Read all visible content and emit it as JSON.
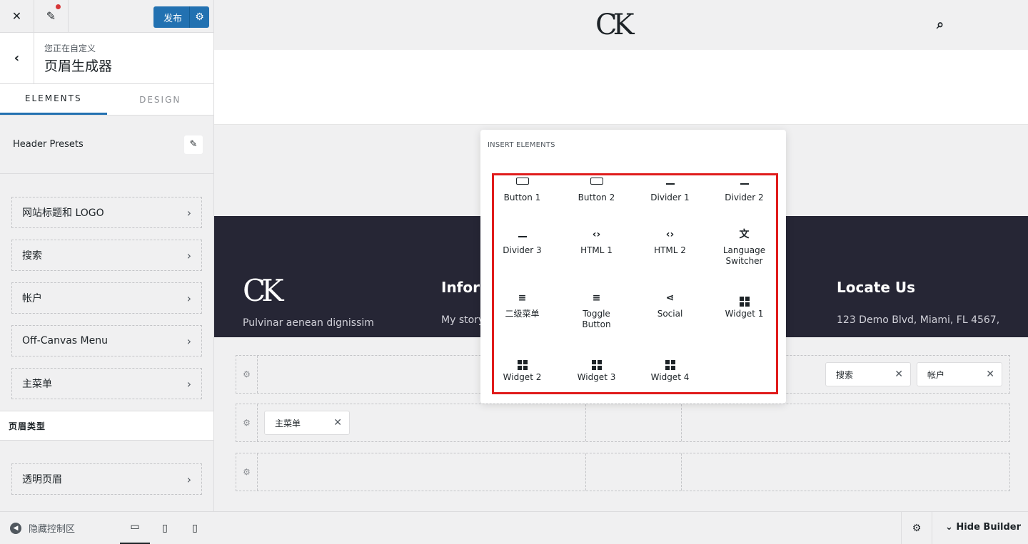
{
  "sidebar": {
    "publish_label": "发布",
    "crumb_sub": "您正在自定义",
    "crumb_title": "页眉生成器",
    "tabs": [
      "ELEMENTS",
      "DESIGN"
    ],
    "presets_label": "Header Presets",
    "items": [
      "网站标题和 LOGO",
      "搜索",
      "帐户",
      "Off-Canvas Menu",
      "主菜单"
    ],
    "section_title": "页眉类型",
    "transparent_item": "透明页眉",
    "hide_controls": "隐藏控制区"
  },
  "preview": {
    "logo": "CK",
    "footer_logo": "CK",
    "footer_text": "Pulvinar aenean dignissim",
    "info_heading": "Infor",
    "story_text": "My story",
    "locate_heading": "Locate Us",
    "address": "123 Demo Blvd, Miami, FL 4567,"
  },
  "builder": {
    "chip_search": "搜索",
    "chip_account": "帐户",
    "chip_menu": "主菜单",
    "hide_builder": "Hide Builder"
  },
  "popup": {
    "title": "INSERT ELEMENTS",
    "elements": [
      {
        "label": "Button 1",
        "icon": "button-icon"
      },
      {
        "label": "Button 2",
        "icon": "button-icon"
      },
      {
        "label": "Divider 1",
        "icon": "divider-icon"
      },
      {
        "label": "Divider 2",
        "icon": "divider-icon"
      },
      {
        "label": "Divider 3",
        "icon": "divider-icon"
      },
      {
        "label": "HTML 1",
        "icon": "code-icon"
      },
      {
        "label": "HTML 2",
        "icon": "code-icon"
      },
      {
        "label": "Language Switcher",
        "icon": "translate-icon"
      },
      {
        "label": "二级菜单",
        "icon": "menu-icon"
      },
      {
        "label": "Toggle Button",
        "icon": "menu-icon"
      },
      {
        "label": "Social",
        "icon": "share-icon"
      },
      {
        "label": "Widget 1",
        "icon": "widget-icon"
      },
      {
        "label": "Widget 2",
        "icon": "widget-icon"
      },
      {
        "label": "Widget 3",
        "icon": "widget-icon"
      },
      {
        "label": "Widget 4",
        "icon": "widget-icon"
      }
    ]
  },
  "colors": {
    "accent": "#2271b1",
    "highlight_border": "#e01b1b",
    "dark_footer": "#262635"
  }
}
